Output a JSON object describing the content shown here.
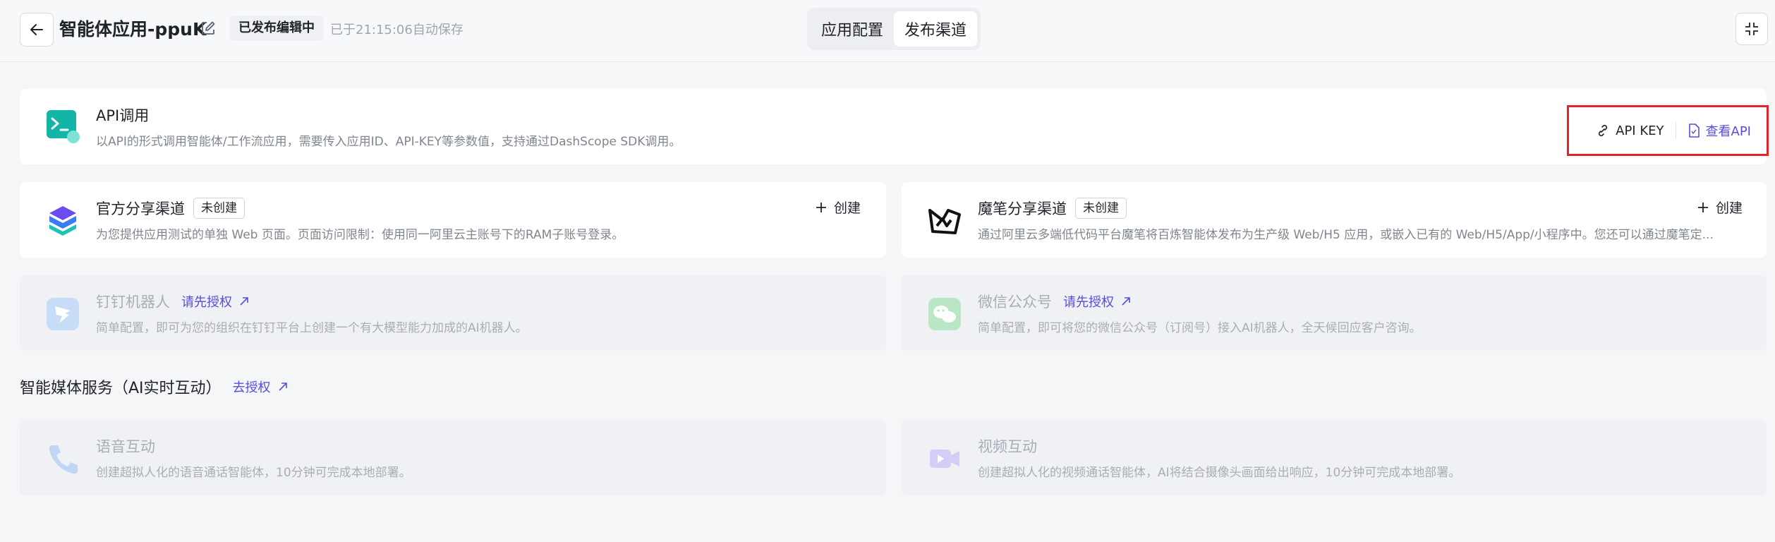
{
  "header": {
    "app_title": "智能体应用-ppuK",
    "status_tag": "已发布编辑中",
    "autosave_text": "已于21:15:06自动保存",
    "tabs": [
      {
        "label": "应用配置",
        "active": false
      },
      {
        "label": "发布渠道",
        "active": true
      }
    ]
  },
  "api_card": {
    "title": "API调用",
    "description": "以API的形式调用智能体/工作流应用，需要传入应用ID、API-KEY等参数值，支持通过DashScope SDK调用。",
    "api_key_label": "API KEY",
    "view_api_label": "查看API"
  },
  "official_share": {
    "title": "官方分享渠道",
    "tag": "未创建",
    "create_label": "创建",
    "description": "为您提供应用测试的单独 Web 页面。页面访问限制：使用同一阿里云主账号下的RAM子账号登录。"
  },
  "mobi_share": {
    "title": "魔笔分享渠道",
    "tag": "未创建",
    "create_label": "创建",
    "description": "通过阿里云多端低代码平台魔笔将百炼智能体发布为生产级 Web/H5 应用，或嵌入已有的 Web/H5/App/小程序中。您还可以通过魔笔定..."
  },
  "dingtalk": {
    "title": "钉钉机器人",
    "auth_label": "请先授权",
    "description": "简单配置，即可为您的组织在钉钉平台上创建一个有大模型能力加成的AI机器人。"
  },
  "wechat": {
    "title": "微信公众号",
    "auth_label": "请先授权",
    "description": "简单配置，即可将您的微信公众号（订阅号）接入AI机器人，全天候回应客户咨询。"
  },
  "media_section": {
    "title": "智能媒体服务（AI实时互动）",
    "auth_label": "去授权"
  },
  "voice": {
    "title": "语音互动",
    "description": "创建超拟人化的语音通话智能体，10分钟可完成本地部署。"
  },
  "video": {
    "title": "视频互动",
    "description": "创建超拟人化的视频通话智能体，AI将结合摄像头画面给出响应，10分钟可完成本地部署。"
  },
  "colors": {
    "accent": "#5a4cdb",
    "highlight_border": "#e0262b",
    "api_teal": "#12b5a6"
  }
}
